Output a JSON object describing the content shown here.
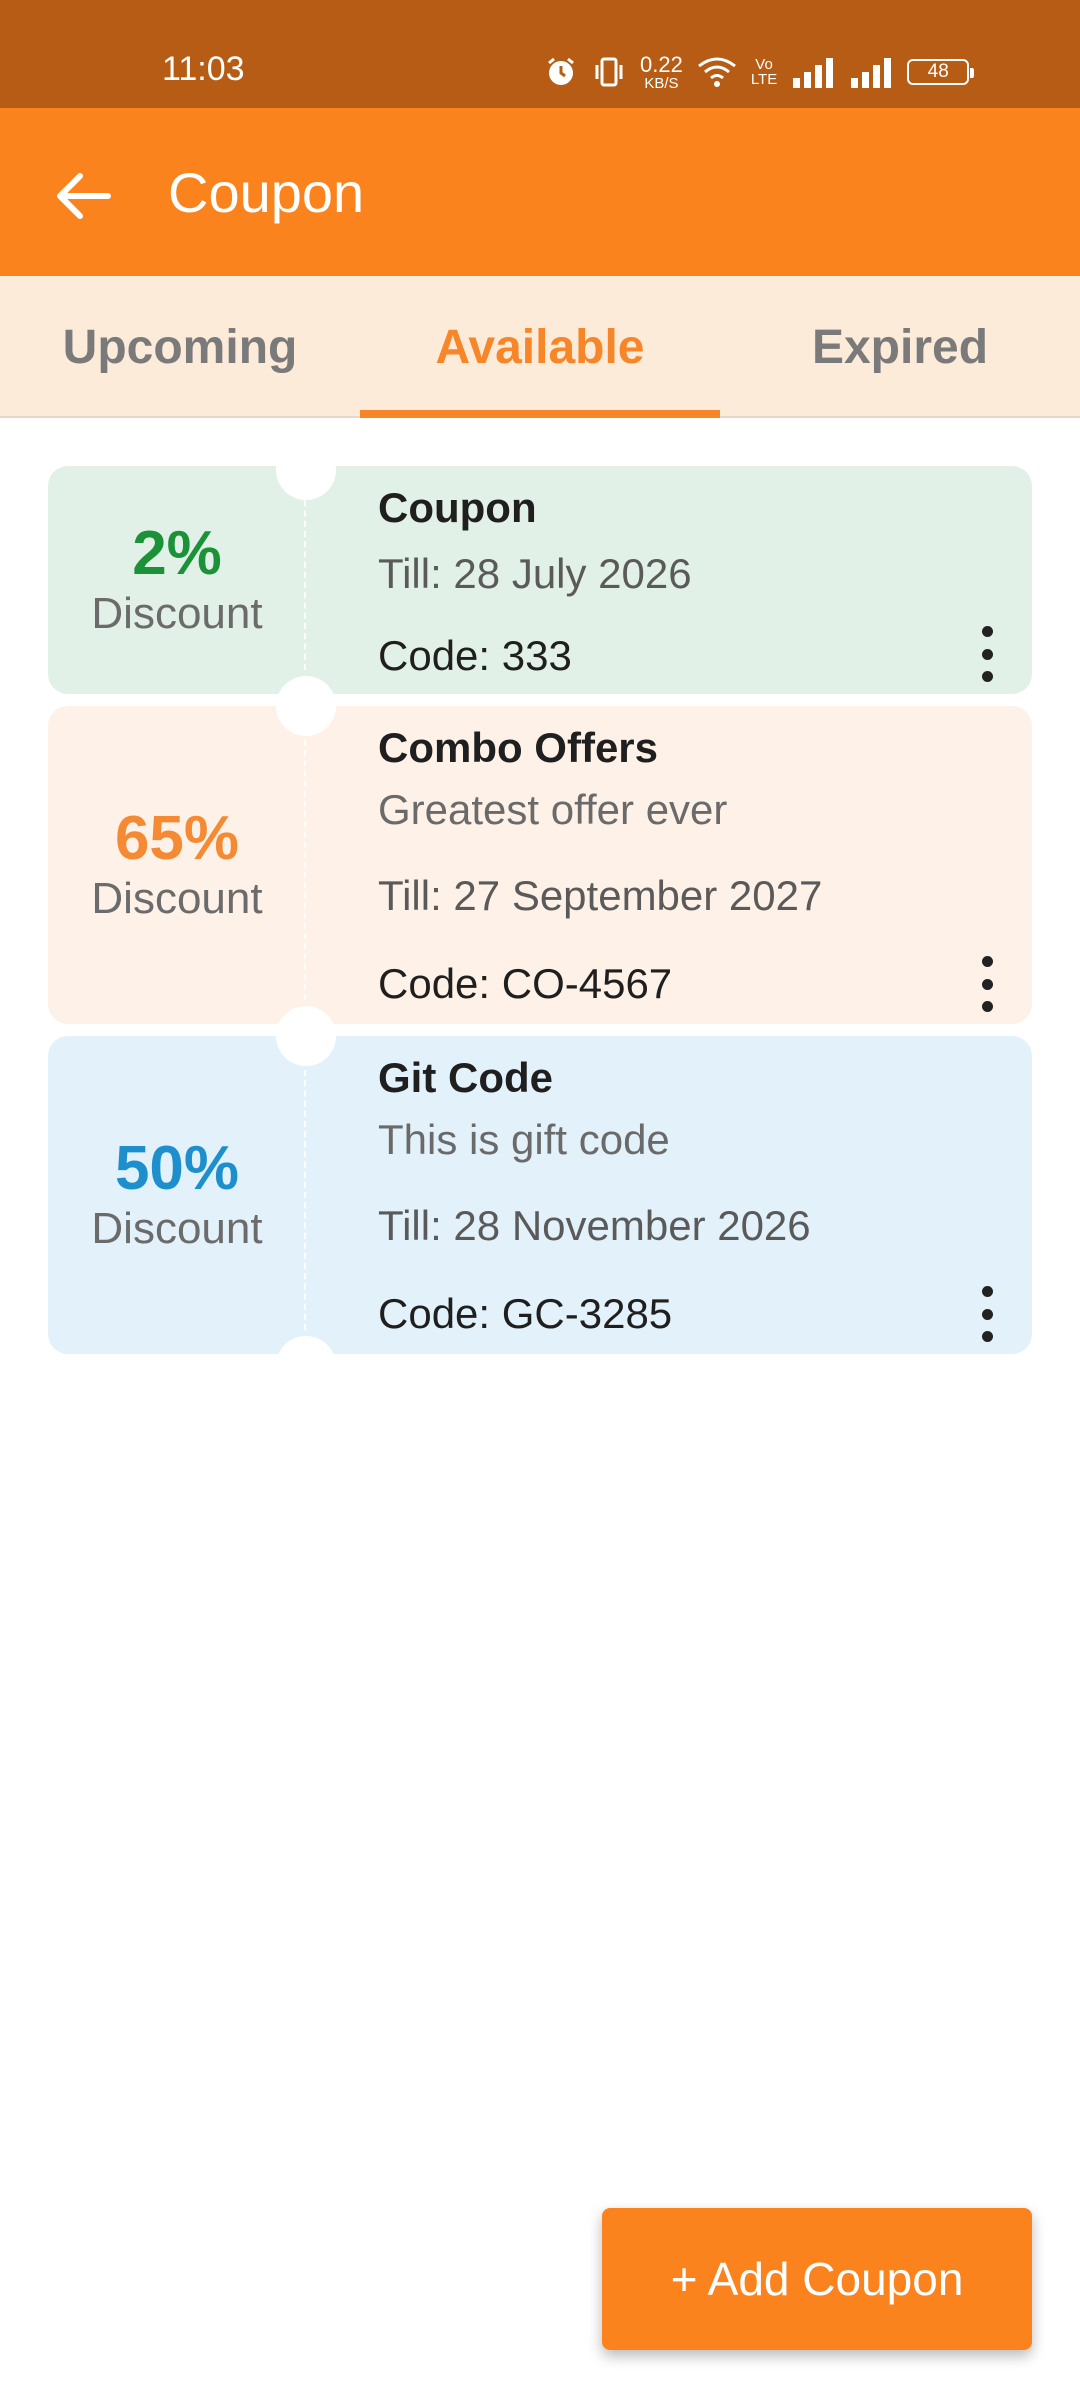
{
  "status_bar": {
    "time": "11:03",
    "net_speed_value": "0.22",
    "net_speed_unit": "KB/S",
    "volte_top": "Vo",
    "volte_bottom": "LTE",
    "battery": "48"
  },
  "app_bar": {
    "title": "Coupon"
  },
  "tabs": [
    {
      "label": "Upcoming"
    },
    {
      "label": "Available"
    },
    {
      "label": "Expired"
    }
  ],
  "active_tab": "Available",
  "coupons": [
    {
      "percent": "2%",
      "discount_label": "Discount",
      "title": "Coupon",
      "description": "",
      "till": "Till: 28 July 2026",
      "code": "Code: 333",
      "bg_color": "#E2F1E8",
      "accent_color": "#1B9138"
    },
    {
      "percent": "65%",
      "discount_label": "Discount",
      "title": "Combo Offers",
      "description": "Greatest offer ever",
      "till": "Till: 27 September 2027",
      "code": "Code: CO-4567",
      "bg_color": "#FEF1E7",
      "accent_color": "#F48A34"
    },
    {
      "percent": "50%",
      "discount_label": "Discount",
      "title": "Git Code",
      "description": "This is gift code",
      "till": "Till: 28 November 2026",
      "code": "Code: GC-3285",
      "bg_color": "#E3F2FA",
      "accent_color": "#1E8FCD"
    }
  ],
  "fab": {
    "label": "+ Add Coupon"
  },
  "colors": {
    "status_bar": "#B75C14",
    "app_bar": "#FB831E",
    "tabs_bg": "#FDEBD9",
    "tab_active": "#F78628"
  },
  "icons": {
    "back": "arrow-left-icon",
    "more": "more-vertical-icon"
  }
}
